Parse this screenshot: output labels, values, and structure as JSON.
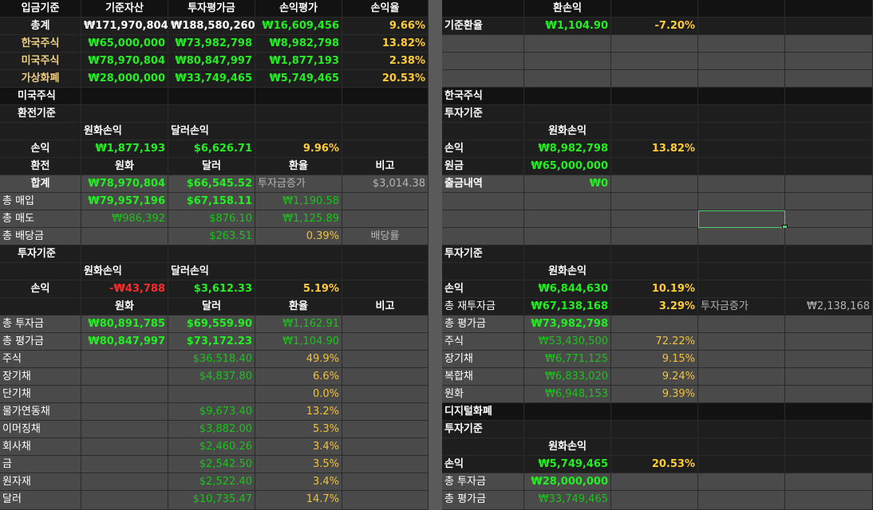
{
  "header": {
    "h0": "입금기준",
    "h1": "기준자산",
    "h2": "투자평가금",
    "h3": "손익평가",
    "h4": "손익율",
    "h6": "환손익"
  },
  "summary": [
    {
      "label": "총계",
      "base": "₩171,970,804",
      "eval": "₩188,580,260",
      "pl": "₩16,609,456",
      "rate": "9.66%"
    },
    {
      "label": "한국주식",
      "base": "₩65,000,000",
      "eval": "₩73,982,798",
      "pl": "₩8,982,798",
      "rate": "13.82%"
    },
    {
      "label": "미국주식",
      "base": "₩78,970,804",
      "eval": "₩80,847,997",
      "pl": "₩1,877,193",
      "rate": "2.38%"
    },
    {
      "label": "가상화폐",
      "base": "₩28,000,000",
      "eval": "₩33,749,465",
      "pl": "₩5,749,465",
      "rate": "20.53%"
    }
  ],
  "fx": {
    "label": "기준환율",
    "value": "₩1,104.90",
    "rate": "-7.20%"
  },
  "us": {
    "title": "미국주식",
    "exchange_basis": "환전기준",
    "krw_pl_h": "원화손익",
    "usd_pl_h": "달러손익",
    "pl_label": "손익",
    "pl_krw": "₩1,877,193",
    "pl_usd": "$6,626.71",
    "pl_rate": "9.96%",
    "cols": {
      "c0": "환전",
      "c1": "원화",
      "c2": "달러",
      "c3": "환율",
      "c4": "비고"
    },
    "sum": {
      "label": "합계",
      "krw": "₩78,970,804",
      "usd": "$66,545.52",
      "note": "투자금증가",
      "extra": "$3,014.38"
    },
    "buy": {
      "label": "총 매입",
      "krw": "₩79,957,196",
      "usd": "$67,158.11",
      "fx": "₩1,190.58"
    },
    "sell": {
      "label": "총 매도",
      "krw": "₩986,392",
      "usd": "$876.10",
      "fx": "₩1,125.89"
    },
    "div": {
      "label": "총 배당금",
      "usd": "$263.51",
      "pct": "0.39%",
      "note": "배당률"
    },
    "invest_basis": "투자기준",
    "ipl_label": "손익",
    "ipl_krw": "-₩43,788",
    "ipl_usd": "$3,612.33",
    "ipl_rate": "5.19%",
    "cols2": {
      "c1": "원화",
      "c2": "달러",
      "c3": "환율",
      "c4": "비고"
    },
    "tinv": {
      "label": "총 투자금",
      "krw": "₩80,891,785",
      "usd": "$69,559.90",
      "fx": "₩1,162.91"
    },
    "teval": {
      "label": "총 평가금",
      "krw": "₩80,847,997",
      "usd": "$73,172.23",
      "fx": "₩1,104.90"
    },
    "assets": [
      {
        "name": "주식",
        "usd": "$36,518.40",
        "pct": "49.9%"
      },
      {
        "name": "장기채",
        "usd": "$4,837.80",
        "pct": "6.6%"
      },
      {
        "name": "단기채",
        "usd": "",
        "pct": "0.0%"
      },
      {
        "name": "물가연동채",
        "usd": "$9,673.40",
        "pct": "13.2%"
      },
      {
        "name": "이머징채",
        "usd": "$3,882.00",
        "pct": "5.3%"
      },
      {
        "name": "회사채",
        "usd": "$2,460.26",
        "pct": "3.4%"
      },
      {
        "name": "금",
        "usd": "$2,542.50",
        "pct": "3.5%"
      },
      {
        "name": "원자재",
        "usd": "$2,522.40",
        "pct": "3.4%"
      },
      {
        "name": "달러",
        "usd": "$10,735.47",
        "pct": "14.7%"
      }
    ]
  },
  "kr": {
    "title": "한국주식",
    "basis1": "투자기준",
    "krw_pl_h": "원화손익",
    "pl_label": "손익",
    "pl": "₩8,982,798",
    "rate": "13.82%",
    "principal_label": "원금",
    "principal": "₩65,000,000",
    "withdraw_label": "출금내역",
    "withdraw": "₩0",
    "basis2": "투자기준",
    "krw_pl_h2": "원화손익",
    "pl2_label": "손익",
    "pl2": "₩6,844,630",
    "rate2": "10.19%",
    "reinv_label": "총 재투자금",
    "reinv": "₩67,138,168",
    "reinv_pct": "3.29%",
    "reinv_note": "투자금증가",
    "reinv_extra": "₩2,138,168",
    "eval_label": "총 평가금",
    "eval": "₩73,982,798",
    "assets": [
      {
        "name": "주식",
        "krw": "₩53,430,500",
        "pct": "72.22%"
      },
      {
        "name": "장기채",
        "krw": "₩6,771,125",
        "pct": "9.15%"
      },
      {
        "name": "복합채",
        "krw": "₩6,833,020",
        "pct": "9.24%"
      },
      {
        "name": "원화",
        "krw": "₩6,948,153",
        "pct": "9.39%"
      }
    ]
  },
  "crypto": {
    "title": "디지털화폐",
    "basis": "투자기준",
    "krw_pl_h": "원화손익",
    "pl_label": "손익",
    "pl": "₩5,749,465",
    "rate": "20.53%",
    "inv_label": "총 투자금",
    "inv": "₩28,000,000",
    "eval_label": "총 평가금",
    "eval": "₩33,749,465"
  }
}
